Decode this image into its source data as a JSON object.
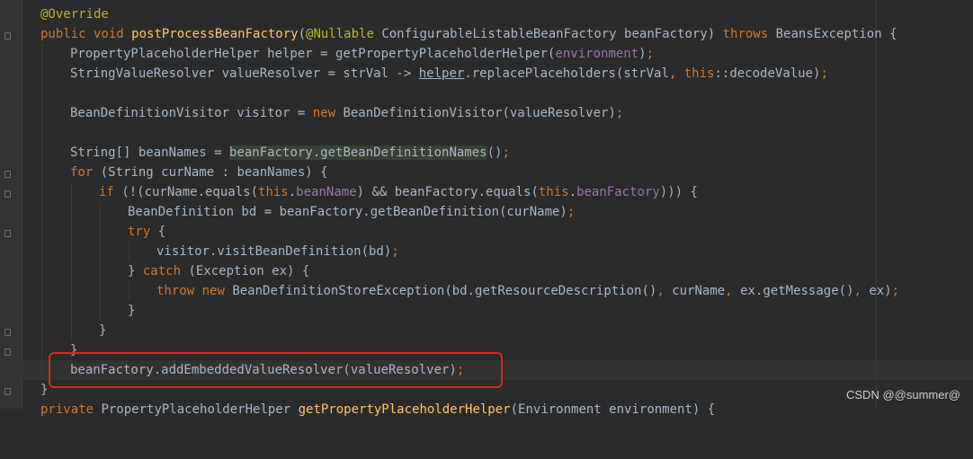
{
  "editor": {
    "lines": {
      "l1": {
        "annotation": "@Override"
      },
      "l2": {
        "mod": "public void ",
        "method": "postProcessBeanFactory",
        "open": "(",
        "nullable": "@Nullable",
        "param": " ConfigurableListableBeanFactory beanFactory) ",
        "throws": "throws",
        "exc": " BeansException {"
      },
      "l3": {
        "a": "PropertyPlaceholderHelper helper = getPropertyPlaceholderHelper(",
        "field": "environment",
        "b": ")",
        "semi": ";"
      },
      "l4": {
        "a": "StringValueResolver valueResolver = strVal -> ",
        "helper": "helper",
        "b": ".replacePlaceholders(strVal",
        "comma": ", ",
        "this": "this",
        "c": "::decodeValue)",
        "semi": ";"
      },
      "l6": {
        "a": "BeanDefinitionVisitor visitor = ",
        "new": "new",
        "b": " BeanDefinitionVisitor(valueResolver)",
        "semi": ";"
      },
      "l8": {
        "a": "String[] beanNames = ",
        "hl": "beanFactory.getBeanDefinitionNames",
        "b": "()",
        "semi": ";"
      },
      "l9": {
        "for": "for",
        "a": " (String curName : beanNames) {"
      },
      "l10": {
        "if": "if",
        "a": " (!(curName.equals(",
        "this1": "this",
        "dot1": ".",
        "f1": "beanName",
        "b": ") && beanFactory.equals(",
        "this2": "this",
        "dot2": ".",
        "f2": "beanFactory",
        "c": "))) {"
      },
      "l11": {
        "a": "BeanDefinition bd = beanFactory.getBeanDefinition(curName)",
        "semi": ";"
      },
      "l12": {
        "try": "try",
        "a": " {"
      },
      "l13": {
        "a": "visitor.visitBeanDefinition(bd)",
        "semi": ";"
      },
      "l14": {
        "a": "} ",
        "catch": "catch",
        "b": " (Exception ex) {"
      },
      "l15": {
        "throw": "throw",
        "sp": " ",
        "new": "new",
        "a": " BeanDefinitionStoreException(bd.getResourceDescription()",
        "c1": ", ",
        "b": "curName",
        "c2": ", ",
        "c": "ex.getMessage()",
        "c3": ", ",
        "d": "ex)",
        "semi": ";"
      },
      "l16": {
        "a": "}"
      },
      "l17": {
        "a": "}"
      },
      "l18": {
        "a": "}"
      },
      "l19": {
        "a": "beanFactory.addEmbeddedValueResolver(valueResolver)",
        "semi": ";"
      },
      "l20": {
        "a": "}"
      },
      "l21": {
        "mod": "private ",
        "a": "PropertyPlaceholderHelper ",
        "method": "getPropertyPlaceholderHelper",
        "b": "(Environment environment) {"
      }
    }
  },
  "watermark": "CSDN @@summer@",
  "colors": {
    "keyword": "#cc7832",
    "annotation": "#bbb529",
    "method": "#ffc66d",
    "field": "#9876aa",
    "text": "#a9b7c6",
    "highlight_box": "#e3261f"
  }
}
